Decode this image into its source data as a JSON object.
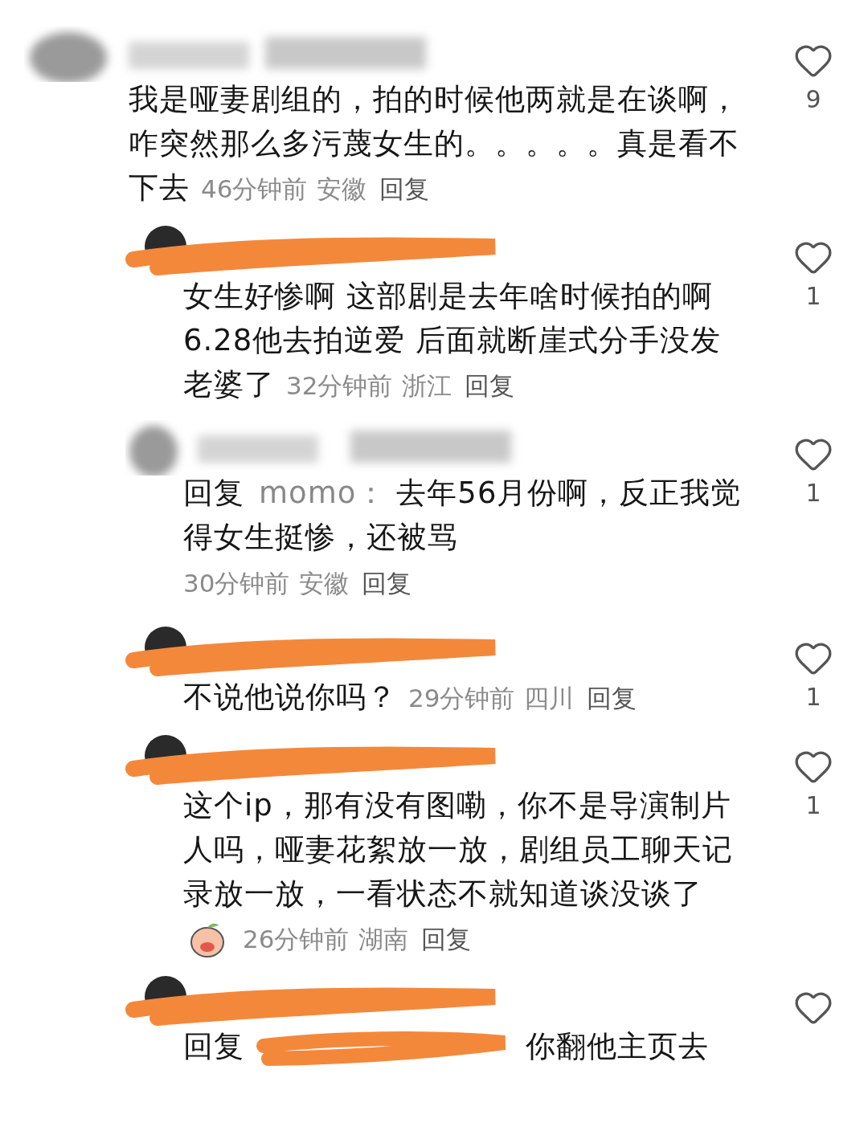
{
  "comments": [
    {
      "name_cover": {
        "kind": "blur"
      },
      "text": "我是哑妻剧组的，拍的时候他两就是在谈啊，咋突然那么多污蔑女生的。。。。。真是看不下去",
      "time": "46分钟前",
      "location": "安徽",
      "reply_label": "回复",
      "likes": "9",
      "children": [
        {
          "name_cover": {
            "kind": "scribble"
          },
          "text": "女生好惨啊 这部剧是去年啥时候拍的啊 6.28他去拍逆爱 后面就断崖式分手没发老婆了",
          "time": "32分钟前",
          "location": "浙江",
          "reply_label": "回复",
          "likes": "1"
        },
        {
          "name_cover": {
            "kind": "blur"
          },
          "reply_prefix": "回复",
          "reply_to": "momo：",
          "text": "去年56月份啊，反正我觉得女生挺惨，还被骂",
          "meta_on_new_line": true,
          "time": "30分钟前",
          "location": "安徽",
          "reply_label": "回复",
          "likes": "1"
        },
        {
          "name_cover": {
            "kind": "scribble"
          },
          "text": "不说他说你吗？",
          "time": "29分钟前",
          "location": "四川",
          "reply_label": "回复",
          "likes": "1"
        },
        {
          "name_cover": {
            "kind": "scribble"
          },
          "text": "这个ip，那有没有图嘞，你不是导演制片人吗，哑妻花絮放一放，剧组员工聊天记录放一放，一看状态不就知道谈没谈了",
          "sticker": true,
          "time": "26分钟前",
          "location": "湖南",
          "reply_label": "回复",
          "likes": "1"
        },
        {
          "name_cover": {
            "kind": "scribble"
          },
          "reply_prefix": "回复",
          "reply_to_cover": {
            "kind": "scribble"
          },
          "text": "你翻他主页去"
        }
      ]
    }
  ]
}
